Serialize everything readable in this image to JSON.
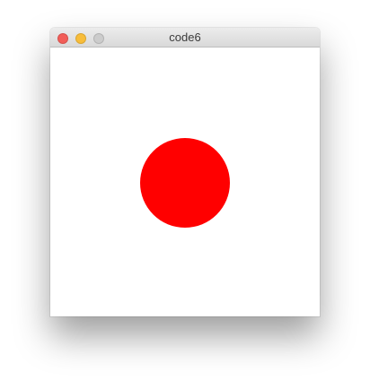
{
  "window": {
    "title": "code6",
    "controls": {
      "close_color": "#f25d58",
      "minimize_color": "#f8bd3a",
      "zoom_color": "#cccccc"
    }
  },
  "canvas": {
    "background": "#ffffff",
    "shape": "circle",
    "shape_color": "#ff0000"
  }
}
